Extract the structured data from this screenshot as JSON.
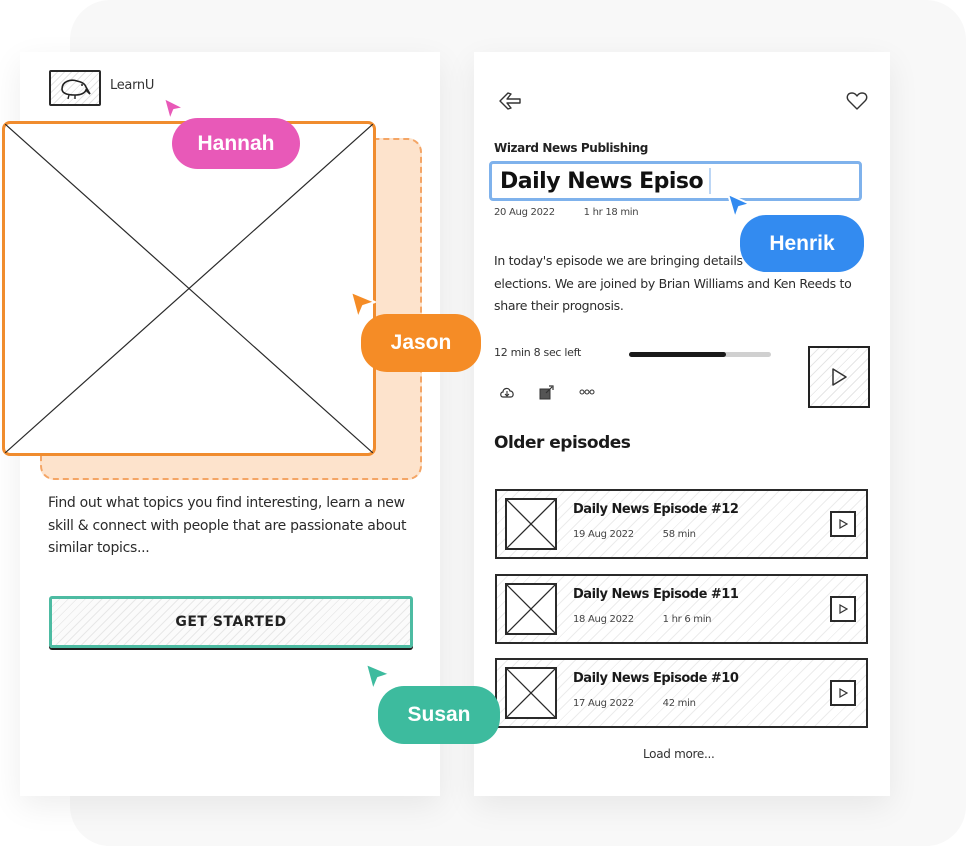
{
  "left_screen": {
    "logo_icon": "kiwi-bird-icon",
    "logo_text": "LearnU",
    "image_placeholder": "image-placeholder",
    "intro_text": "Find out what topics you find interesting, learn a new skill & connect with people that are passionate about similar topics...",
    "cta_label": "GET STARTED"
  },
  "right_screen": {
    "back_icon": "arrow-left-icon",
    "favorite_icon": "heart-icon",
    "publisher": "Wizard News Publishing",
    "title_input_value": "Daily News Episo",
    "date": "20 Aug 2022",
    "duration": "1 hr 18 min",
    "description": "In today's episode we are bringing details of upcoming city elections. We are joined by Brian Williams and Ken Reeds to share their prognosis.",
    "time_left": "12 min 8 sec left",
    "progress_fraction": 0.68,
    "actions": [
      {
        "icon": "cloud-download-icon"
      },
      {
        "icon": "share-icon"
      },
      {
        "icon": "more-icon"
      }
    ],
    "older_title": "Older episodes",
    "episodes": [
      {
        "title": "Daily News Episode #12",
        "date": "19 Aug 2022",
        "duration": "58 min"
      },
      {
        "title": "Daily News Episode #11",
        "date": "18 Aug 2022",
        "duration": "1 hr 6 min"
      },
      {
        "title": "Daily News Episode #10",
        "date": "17 Aug 2022",
        "duration": "42 min"
      }
    ],
    "load_more": "Load more..."
  },
  "collaborators": [
    {
      "name": "Hannah",
      "color": "#e859b8"
    },
    {
      "name": "Henrik",
      "color": "#338bf0"
    },
    {
      "name": "Jason",
      "color": "#f58c26"
    },
    {
      "name": "Susan",
      "color": "#3dbb9e"
    }
  ]
}
